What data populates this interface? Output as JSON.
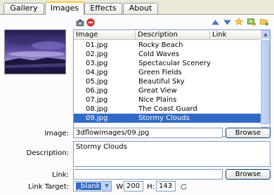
{
  "tabs": [
    {
      "label": "Gallery"
    },
    {
      "label": "Images"
    },
    {
      "label": "Effects"
    },
    {
      "label": "About"
    }
  ],
  "toolbar": {
    "left_icons": [
      "camera-add-icon",
      "delete-icon"
    ],
    "right_icons": [
      "arrow-up-icon",
      "arrow-down-icon",
      "star-icon",
      "image-add-icon",
      "folder-add-icon"
    ]
  },
  "list": {
    "columns": [
      "Image",
      "Description",
      "Link"
    ],
    "rows": [
      {
        "file": "01.jpg",
        "description": "Rocky Beach"
      },
      {
        "file": "02.jpg",
        "description": "Cold Waves"
      },
      {
        "file": "03.jpg",
        "description": "Spectacular Scenery"
      },
      {
        "file": "04.jpg",
        "description": "Green Fields"
      },
      {
        "file": "05.jpg",
        "description": "Beautiful Sky"
      },
      {
        "file": "06.jpg",
        "description": "Great View"
      },
      {
        "file": "07.jpg",
        "description": "Nice Plains"
      },
      {
        "file": "08.jpg",
        "description": "The Coast Guard"
      },
      {
        "file": "09.jpg",
        "description": "Stormy Clouds"
      }
    ],
    "selected_index": 8
  },
  "form": {
    "image_label": "Image:",
    "image_value": "3dflowimages/09.jpg",
    "browse_label": "Browse",
    "description_label": "Description:",
    "description_value": "Stormy Clouds",
    "link_label": "Link:",
    "link_value": "",
    "link_browse_label": "Browse",
    "target_label": "Link Target:",
    "target_value": "_blank",
    "w_label": "W:",
    "w_value": "200",
    "h_label": "H:",
    "h_value": "143"
  },
  "colors": {
    "selection": "#316ac5",
    "active_tab_accent": "#ffc83c",
    "field_border": "#7f9db9"
  }
}
